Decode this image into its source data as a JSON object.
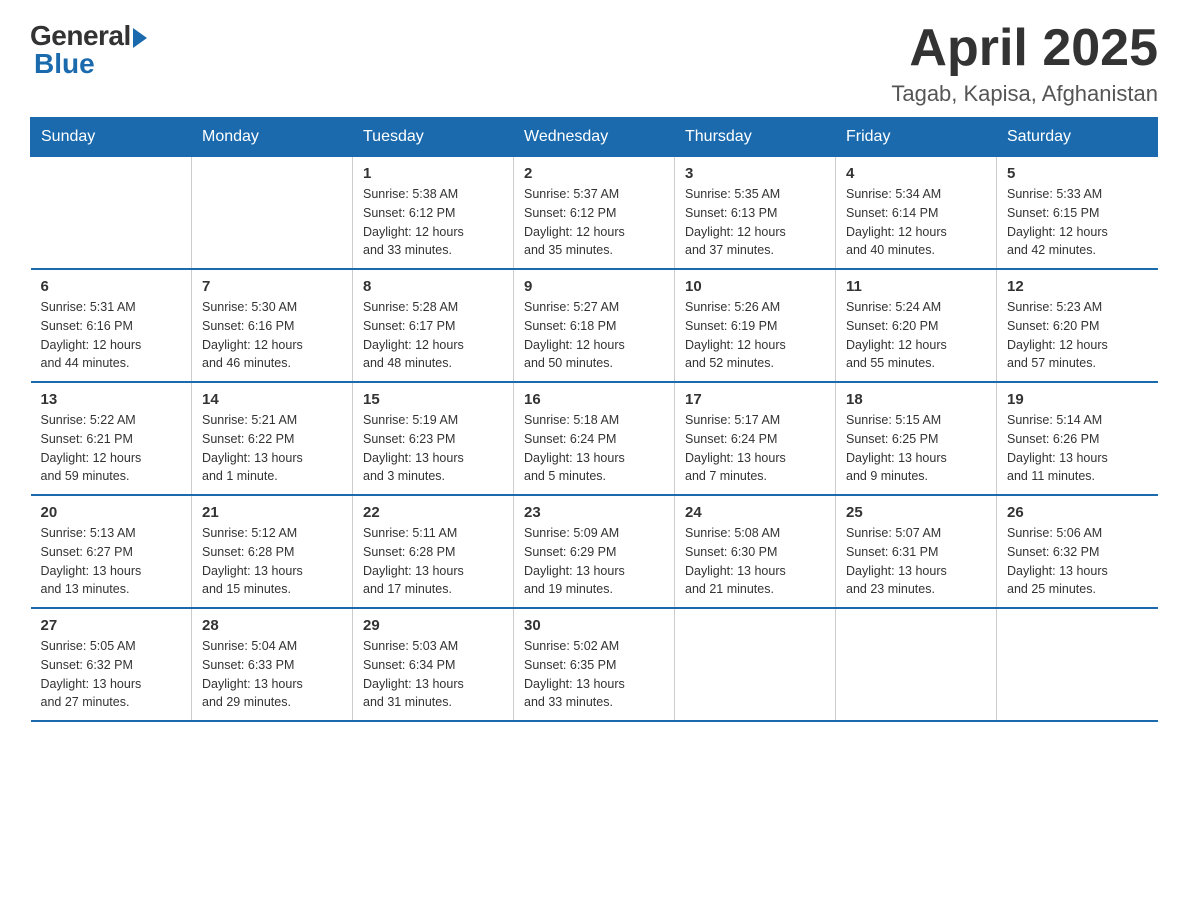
{
  "logo": {
    "general": "General",
    "blue": "Blue"
  },
  "title": "April 2025",
  "location": "Tagab, Kapisa, Afghanistan",
  "days_header": [
    "Sunday",
    "Monday",
    "Tuesday",
    "Wednesday",
    "Thursday",
    "Friday",
    "Saturday"
  ],
  "weeks": [
    [
      {
        "num": "",
        "detail": ""
      },
      {
        "num": "",
        "detail": ""
      },
      {
        "num": "1",
        "detail": "Sunrise: 5:38 AM\nSunset: 6:12 PM\nDaylight: 12 hours\nand 33 minutes."
      },
      {
        "num": "2",
        "detail": "Sunrise: 5:37 AM\nSunset: 6:12 PM\nDaylight: 12 hours\nand 35 minutes."
      },
      {
        "num": "3",
        "detail": "Sunrise: 5:35 AM\nSunset: 6:13 PM\nDaylight: 12 hours\nand 37 minutes."
      },
      {
        "num": "4",
        "detail": "Sunrise: 5:34 AM\nSunset: 6:14 PM\nDaylight: 12 hours\nand 40 minutes."
      },
      {
        "num": "5",
        "detail": "Sunrise: 5:33 AM\nSunset: 6:15 PM\nDaylight: 12 hours\nand 42 minutes."
      }
    ],
    [
      {
        "num": "6",
        "detail": "Sunrise: 5:31 AM\nSunset: 6:16 PM\nDaylight: 12 hours\nand 44 minutes."
      },
      {
        "num": "7",
        "detail": "Sunrise: 5:30 AM\nSunset: 6:16 PM\nDaylight: 12 hours\nand 46 minutes."
      },
      {
        "num": "8",
        "detail": "Sunrise: 5:28 AM\nSunset: 6:17 PM\nDaylight: 12 hours\nand 48 minutes."
      },
      {
        "num": "9",
        "detail": "Sunrise: 5:27 AM\nSunset: 6:18 PM\nDaylight: 12 hours\nand 50 minutes."
      },
      {
        "num": "10",
        "detail": "Sunrise: 5:26 AM\nSunset: 6:19 PM\nDaylight: 12 hours\nand 52 minutes."
      },
      {
        "num": "11",
        "detail": "Sunrise: 5:24 AM\nSunset: 6:20 PM\nDaylight: 12 hours\nand 55 minutes."
      },
      {
        "num": "12",
        "detail": "Sunrise: 5:23 AM\nSunset: 6:20 PM\nDaylight: 12 hours\nand 57 minutes."
      }
    ],
    [
      {
        "num": "13",
        "detail": "Sunrise: 5:22 AM\nSunset: 6:21 PM\nDaylight: 12 hours\nand 59 minutes."
      },
      {
        "num": "14",
        "detail": "Sunrise: 5:21 AM\nSunset: 6:22 PM\nDaylight: 13 hours\nand 1 minute."
      },
      {
        "num": "15",
        "detail": "Sunrise: 5:19 AM\nSunset: 6:23 PM\nDaylight: 13 hours\nand 3 minutes."
      },
      {
        "num": "16",
        "detail": "Sunrise: 5:18 AM\nSunset: 6:24 PM\nDaylight: 13 hours\nand 5 minutes."
      },
      {
        "num": "17",
        "detail": "Sunrise: 5:17 AM\nSunset: 6:24 PM\nDaylight: 13 hours\nand 7 minutes."
      },
      {
        "num": "18",
        "detail": "Sunrise: 5:15 AM\nSunset: 6:25 PM\nDaylight: 13 hours\nand 9 minutes."
      },
      {
        "num": "19",
        "detail": "Sunrise: 5:14 AM\nSunset: 6:26 PM\nDaylight: 13 hours\nand 11 minutes."
      }
    ],
    [
      {
        "num": "20",
        "detail": "Sunrise: 5:13 AM\nSunset: 6:27 PM\nDaylight: 13 hours\nand 13 minutes."
      },
      {
        "num": "21",
        "detail": "Sunrise: 5:12 AM\nSunset: 6:28 PM\nDaylight: 13 hours\nand 15 minutes."
      },
      {
        "num": "22",
        "detail": "Sunrise: 5:11 AM\nSunset: 6:28 PM\nDaylight: 13 hours\nand 17 minutes."
      },
      {
        "num": "23",
        "detail": "Sunrise: 5:09 AM\nSunset: 6:29 PM\nDaylight: 13 hours\nand 19 minutes."
      },
      {
        "num": "24",
        "detail": "Sunrise: 5:08 AM\nSunset: 6:30 PM\nDaylight: 13 hours\nand 21 minutes."
      },
      {
        "num": "25",
        "detail": "Sunrise: 5:07 AM\nSunset: 6:31 PM\nDaylight: 13 hours\nand 23 minutes."
      },
      {
        "num": "26",
        "detail": "Sunrise: 5:06 AM\nSunset: 6:32 PM\nDaylight: 13 hours\nand 25 minutes."
      }
    ],
    [
      {
        "num": "27",
        "detail": "Sunrise: 5:05 AM\nSunset: 6:32 PM\nDaylight: 13 hours\nand 27 minutes."
      },
      {
        "num": "28",
        "detail": "Sunrise: 5:04 AM\nSunset: 6:33 PM\nDaylight: 13 hours\nand 29 minutes."
      },
      {
        "num": "29",
        "detail": "Sunrise: 5:03 AM\nSunset: 6:34 PM\nDaylight: 13 hours\nand 31 minutes."
      },
      {
        "num": "30",
        "detail": "Sunrise: 5:02 AM\nSunset: 6:35 PM\nDaylight: 13 hours\nand 33 minutes."
      },
      {
        "num": "",
        "detail": ""
      },
      {
        "num": "",
        "detail": ""
      },
      {
        "num": "",
        "detail": ""
      }
    ]
  ]
}
